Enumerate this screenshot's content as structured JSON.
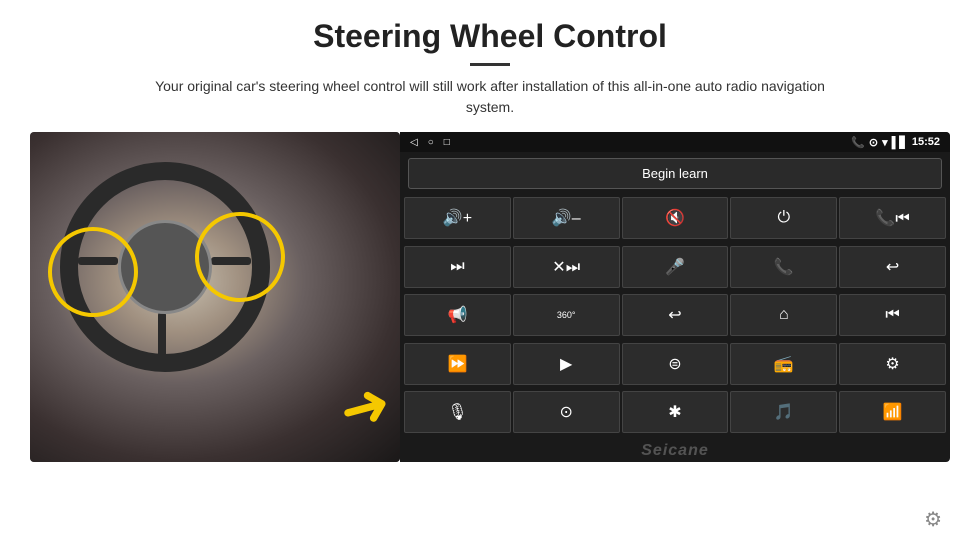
{
  "header": {
    "title": "Steering Wheel Control",
    "divider": true,
    "subtitle": "Your original car's steering wheel control will still work after installation of this all-in-one auto radio navigation system."
  },
  "statusBar": {
    "navIcons": [
      "◁",
      "○",
      "□"
    ],
    "rightIcons": [
      "📞",
      "⊙",
      "▾"
    ],
    "simBars": "▌▋",
    "time": "15:52"
  },
  "beginLearn": {
    "label": "Begin learn"
  },
  "controls": [
    {
      "icon": "🔊+",
      "label": "vol-up"
    },
    {
      "icon": "🔊-",
      "label": "vol-down"
    },
    {
      "icon": "🔇",
      "label": "mute"
    },
    {
      "icon": "⏻",
      "label": "power"
    },
    {
      "icon": "📞⏮",
      "label": "phone-prev"
    },
    {
      "icon": "⏭",
      "label": "next-track"
    },
    {
      "icon": "✕⏭",
      "label": "skip"
    },
    {
      "icon": "🎤",
      "label": "mic"
    },
    {
      "icon": "📞",
      "label": "call"
    },
    {
      "icon": "↩",
      "label": "hang-up"
    },
    {
      "icon": "📢",
      "label": "horn"
    },
    {
      "icon": "360°",
      "label": "camera-360"
    },
    {
      "icon": "↩",
      "label": "back"
    },
    {
      "icon": "⌂",
      "label": "home"
    },
    {
      "icon": "⏮⏮",
      "label": "prev-track"
    },
    {
      "icon": "⏭⏭",
      "label": "fast-fwd"
    },
    {
      "icon": "▶",
      "label": "play"
    },
    {
      "icon": "⊜",
      "label": "source"
    },
    {
      "icon": "📻",
      "label": "radio"
    },
    {
      "icon": "⚙",
      "label": "settings-eq"
    },
    {
      "icon": "🎙",
      "label": "voice"
    },
    {
      "icon": "⊙",
      "label": "menu"
    },
    {
      "icon": "✱",
      "label": "bluetooth"
    },
    {
      "icon": "🎵",
      "label": "music"
    },
    {
      "icon": "📶",
      "label": "signal"
    }
  ],
  "watermark": "Seicane",
  "gear": "⚙"
}
